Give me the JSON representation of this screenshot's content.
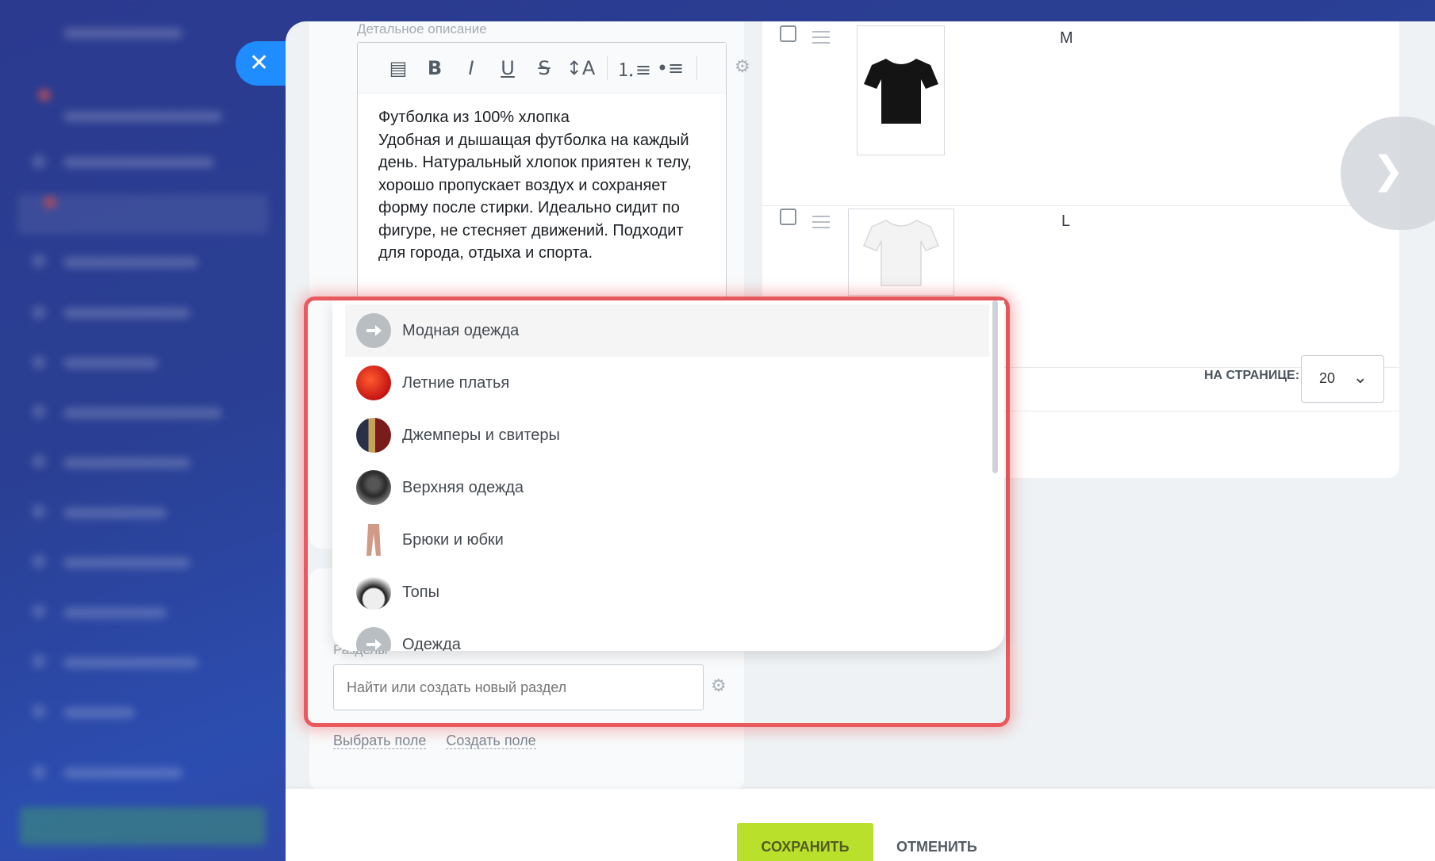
{
  "close_label": "✕",
  "editor": {
    "title": "Детальное описание",
    "toolbar": [
      {
        "name": "media-icon",
        "glyph": "▤",
        "cls": ""
      },
      {
        "name": "bold-button",
        "glyph": "B",
        "cls": "b"
      },
      {
        "name": "italic-button",
        "glyph": "I",
        "cls": "i"
      },
      {
        "name": "underline-button",
        "glyph": "U",
        "cls": "u"
      },
      {
        "name": "strikethrough-button",
        "glyph": "S",
        "cls": "s"
      },
      {
        "name": "font-size-button",
        "glyph": "↕A",
        "cls": ""
      }
    ],
    "toolbar_lists": [
      {
        "name": "ordered-list-button",
        "glyph": "⒈≡"
      },
      {
        "name": "bullet-list-button",
        "glyph": "•≡"
      }
    ],
    "text_title": "Футболка из 100% хлопка",
    "text_body": "Удобная и дышащая футболка на каждый день. Натуральный хлопок приятен к телу, хорошо пропускает воздух и сохраняет форму после стирки. Идеально сидит по фигуре, не стесняет движений. Подходит для города, отдыха и спорта."
  },
  "skus": [
    {
      "size": "M",
      "color": "black"
    },
    {
      "size": "L",
      "color": "white"
    }
  ],
  "per_page": {
    "label": "НА СТРАНИЦЕ:",
    "value": "20"
  },
  "sections": {
    "label": "Разделы",
    "placeholder": "Найти или создать новый раздел"
  },
  "links": {
    "select_field": "Выбрать поле",
    "create_field": "Создать поле"
  },
  "dropdown": [
    {
      "label": "Модная одежда",
      "icon": "arrow-icon",
      "active": true
    },
    {
      "label": "Летние платья",
      "icon": "dress-icon"
    },
    {
      "label": "Джемперы и свитеры",
      "icon": "sweater-icon"
    },
    {
      "label": "Верхняя одежда",
      "icon": "jacket-icon"
    },
    {
      "label": "Брюки и юбки",
      "icon": "pants-icon"
    },
    {
      "label": "Топы",
      "icon": "top-icon"
    },
    {
      "label": "Одежда",
      "icon": "arrow-icon"
    }
  ],
  "buttons": {
    "save": "СОХРАНИТЬ",
    "cancel": "ОТМЕНИТЬ"
  },
  "colors": {
    "accent": "#1f8cff",
    "save": "#b9e02a",
    "highlight": "#e85a5e"
  }
}
